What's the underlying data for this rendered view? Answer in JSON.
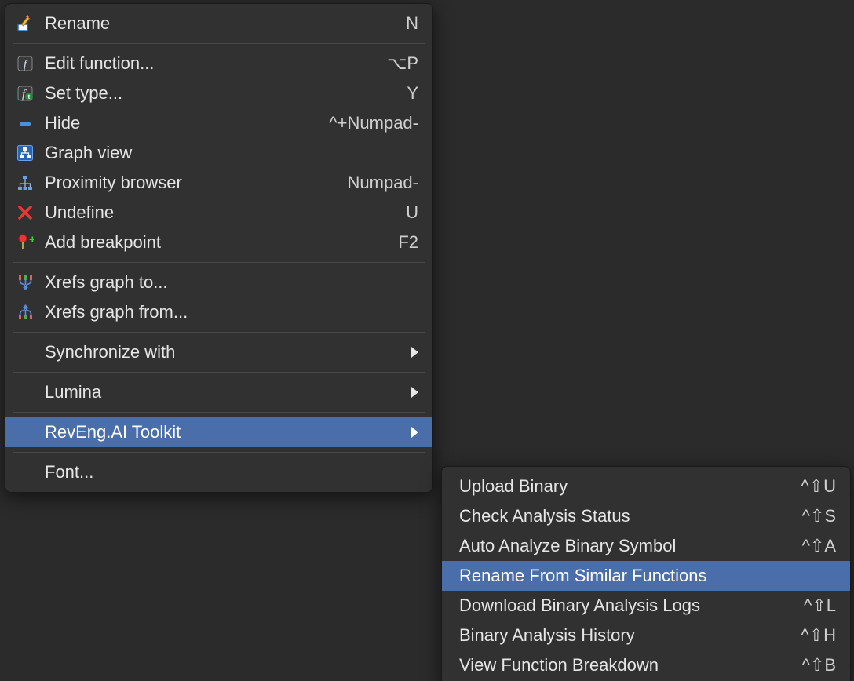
{
  "menu": {
    "items": [
      {
        "icon": "rename-icon",
        "label": "Rename",
        "shortcut": "N"
      },
      {
        "sep": true
      },
      {
        "icon": "function-icon",
        "label": "Edit function...",
        "shortcut": "⌥P"
      },
      {
        "icon": "function-type-icon",
        "label": "Set type...",
        "shortcut": "Y"
      },
      {
        "icon": "hide-icon",
        "label": "Hide",
        "shortcut": "^+Numpad-"
      },
      {
        "icon": "graph-icon",
        "label": "Graph view",
        "shortcut": ""
      },
      {
        "icon": "proximity-icon",
        "label": "Proximity browser",
        "shortcut": "Numpad-"
      },
      {
        "icon": "undefine-icon",
        "label": "Undefine",
        "shortcut": "U"
      },
      {
        "icon": "breakpoint-icon",
        "label": "Add breakpoint",
        "shortcut": "F2"
      },
      {
        "sep": true
      },
      {
        "icon": "xrefs-to-icon",
        "label": "Xrefs graph to...",
        "shortcut": ""
      },
      {
        "icon": "xrefs-from-icon",
        "label": "Xrefs graph from...",
        "shortcut": ""
      },
      {
        "sep": true
      },
      {
        "icon": "",
        "label": "Synchronize with",
        "submenu": true
      },
      {
        "sep": true
      },
      {
        "icon": "",
        "label": "Lumina",
        "submenu": true
      },
      {
        "sep": true
      },
      {
        "icon": "",
        "label": "RevEng.AI Toolkit",
        "submenu": true,
        "highlight": true
      },
      {
        "sep": true
      },
      {
        "icon": "",
        "label": "Font...",
        "shortcut": ""
      }
    ]
  },
  "submenu": {
    "items": [
      {
        "label": "Upload Binary",
        "shortcut": "^⇧U"
      },
      {
        "label": "Check Analysis Status",
        "shortcut": "^⇧S"
      },
      {
        "label": "Auto Analyze Binary Symbol",
        "shortcut": "^⇧A"
      },
      {
        "label": "Rename From Similar Functions",
        "shortcut": "",
        "highlight": true
      },
      {
        "label": "Download Binary Analysis Logs",
        "shortcut": "^⇧L"
      },
      {
        "label": "Binary Analysis History",
        "shortcut": "^⇧H"
      },
      {
        "label": "View Function Breakdown",
        "shortcut": "^⇧B"
      }
    ]
  }
}
